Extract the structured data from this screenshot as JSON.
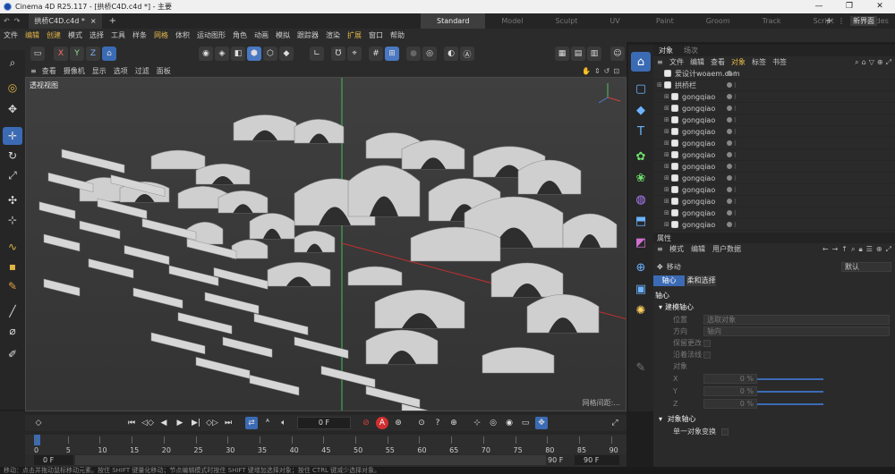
{
  "window": {
    "title": "Cinema 4D R25.117 - [拱桥C4D.c4d *] - 主要",
    "btn_min": "—",
    "btn_max": "❐",
    "btn_close": "✕"
  },
  "doc_tab": {
    "label": "拱桥C4D.c4d *",
    "close": "×",
    "add": "+"
  },
  "layouts": [
    "Standard",
    "Model",
    "Sculpt",
    "UV Edit",
    "Paint",
    "Groom",
    "Track",
    "Script",
    "Nodes"
  ],
  "new_layout": "新界面",
  "menus": [
    "文件",
    "编辑",
    "创建",
    "模式",
    "选择",
    "工具",
    "样条",
    "网格",
    "体积",
    "运动图形",
    "角色",
    "动画",
    "模拟",
    "跟踪器",
    "渲染",
    "扩展",
    "窗口",
    "帮助"
  ],
  "highlight_menus": [
    "编辑",
    "创建",
    "网格",
    "扩展"
  ],
  "view_menus": [
    "查看",
    "摄像机",
    "显示",
    "选项",
    "过滤",
    "面板"
  ],
  "viewport": {
    "label": "透视视图",
    "corner": "网格间距:..."
  },
  "object_panel": {
    "tabs": [
      "对象",
      "场次"
    ],
    "menus": [
      "文件",
      "编辑",
      "查看",
      "对象",
      "标签",
      "书签"
    ],
    "rows": [
      {
        "name": "爱设计woaem.com",
        "level": 0
      },
      {
        "name": "拱桥栏",
        "level": 0
      },
      {
        "name": "gongqiao",
        "level": 1
      },
      {
        "name": "gongqiao",
        "level": 1
      },
      {
        "name": "gongqiao",
        "level": 1
      },
      {
        "name": "gongqiao",
        "level": 1
      },
      {
        "name": "gongqiao",
        "level": 1
      },
      {
        "name": "gongqiao",
        "level": 1
      },
      {
        "name": "gongqiao",
        "level": 1
      },
      {
        "name": "gongqiao",
        "level": 1
      },
      {
        "name": "gongqiao",
        "level": 1
      },
      {
        "name": "gongqiao",
        "level": 1
      },
      {
        "name": "gongqiao",
        "level": 1
      },
      {
        "name": "gongqiao",
        "level": 1
      }
    ]
  },
  "attr_panel": {
    "title": "属性",
    "menus": [
      "模式",
      "编辑",
      "用户数据"
    ],
    "tool": "移动",
    "preset": "默认",
    "tabs": [
      "轴心",
      "柔和选择"
    ],
    "section": "轴心",
    "group1": "建模轴心",
    "pos_label": "位置",
    "pos_value": "选取对象",
    "dir_label": "方向",
    "dir_value": "轴向",
    "keep_label": "保留更改",
    "along_label": "沿着法线",
    "obj_label": "对象",
    "x_label": "X",
    "x_value": "0 %",
    "y_label": "Y",
    "y_value": "0 %",
    "z_label": "Z",
    "z_value": "0 %",
    "group2": "对象轴心",
    "single_label": "单一对象变换"
  },
  "timeline": {
    "current_frame": "0 F",
    "ticks": [
      "0",
      "5",
      "10",
      "15",
      "20",
      "25",
      "30",
      "35",
      "40",
      "45",
      "50",
      "55",
      "60",
      "65",
      "70",
      "75",
      "80",
      "85",
      "90"
    ],
    "start": "0 F",
    "start2": "0 F",
    "end": "90 F",
    "end2": "90 F"
  },
  "status": "移动：点击并拖动鼠标移动元素。按住 SHIFT 键量化移动；节点编辑模式时按住 SHIFT 键增加选择对象；按住 CTRL 键减少选择对象。",
  "colors": {
    "accent": "#3b6bb5",
    "highlight": "#e0b548",
    "bg": "#2b2b2b"
  }
}
